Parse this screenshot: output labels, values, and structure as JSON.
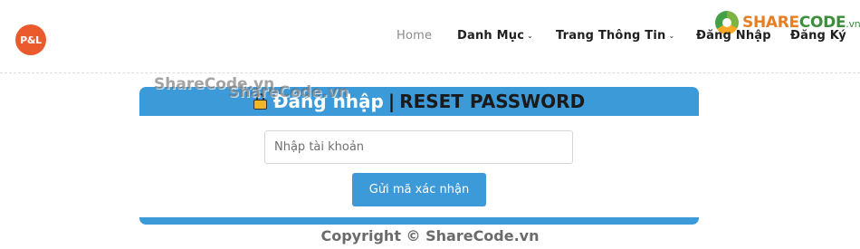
{
  "logo": {
    "text": "P&L",
    "color": "#ea5a2c"
  },
  "nav": {
    "items": [
      {
        "label": "Home",
        "has_dropdown": false
      },
      {
        "label": "Danh Mục",
        "has_dropdown": true
      },
      {
        "label": "Trang Thông Tin",
        "has_dropdown": true
      },
      {
        "label": "Đăng Nhập",
        "has_dropdown": false
      },
      {
        "label": "Đăng Ký",
        "has_dropdown": false
      }
    ],
    "dropdown_icon": "chevron-down-icon"
  },
  "brand_badge": {
    "part1": "SHARE",
    "part2": "CODE",
    "tld": ".vn",
    "icon": "sharecode-logo-icon"
  },
  "card": {
    "title_login": "Đăng nhập",
    "title_separator": "|",
    "title_reset": "RESET PASSWORD",
    "title_icon": "cart-lock-icon",
    "accent_color": "#3d9ad8",
    "account_input": {
      "placeholder": "Nhập tài khoản",
      "value": ""
    },
    "submit_label": "Gửi mã xác nhận"
  },
  "watermarks": {
    "first": "ShareCode.vn",
    "second": "ShareCode.vn"
  },
  "footer": {
    "copyright": "Copyright © ShareCode.vn"
  }
}
